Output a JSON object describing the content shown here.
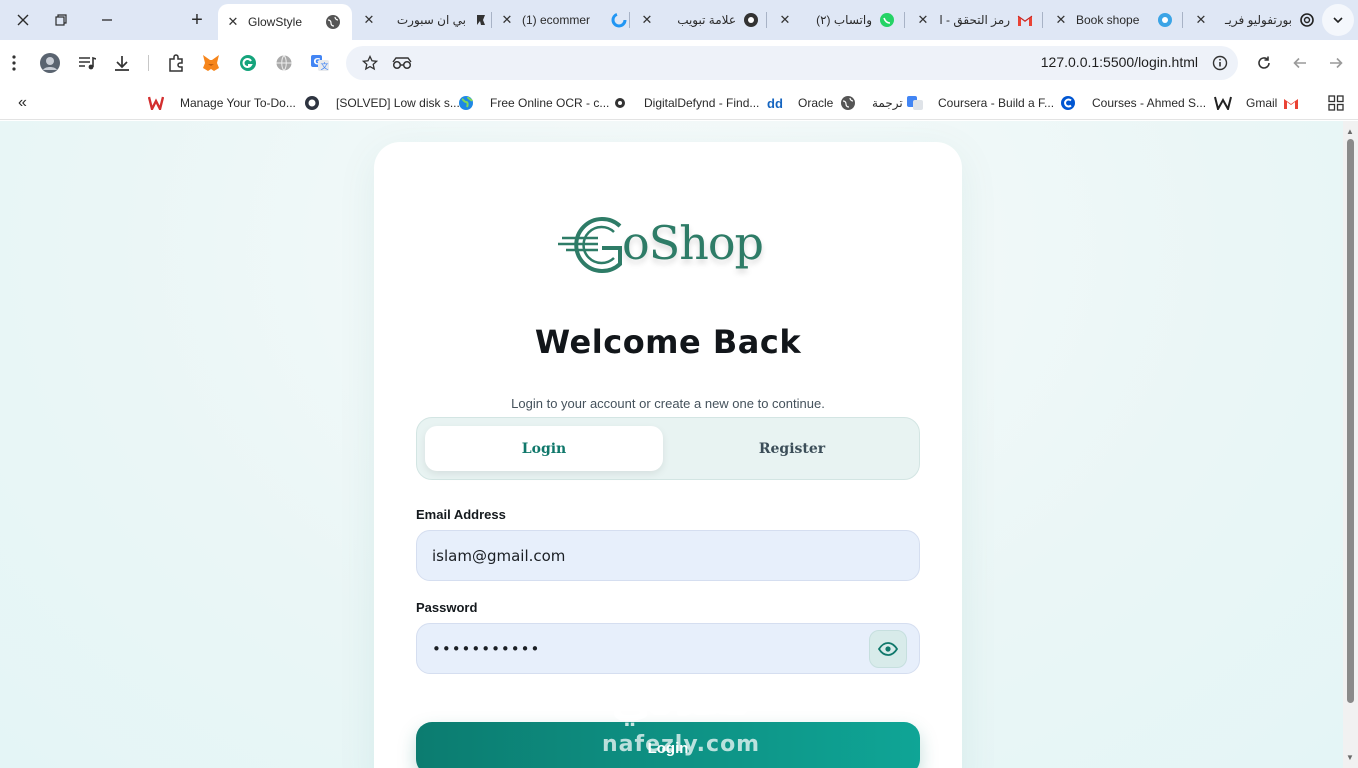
{
  "browser": {
    "tabs": [
      {
        "title": "بورتفوليو فريـ",
        "icon": "chatgpt-icon"
      },
      {
        "title": "Book shope",
        "icon": "circle-blue-icon"
      },
      {
        "title": "رمز التحقق - ا",
        "icon": "gmail-icon"
      },
      {
        "title": "(٢) واتساب",
        "icon": "whatsapp-icon"
      },
      {
        "title": "علامة تبويب",
        "icon": "chrome-icon"
      },
      {
        "title": "(1) ecommer",
        "icon": "blue-spinner-icon"
      },
      {
        "title": "بي ان سبورت",
        "icon": "pin-icon"
      },
      {
        "title": "GlowStyle",
        "icon": "globe-icon",
        "active": true
      }
    ],
    "new_tab": "+",
    "url": "127.0.0.1:5500/login.html",
    "bookmarks": [
      {
        "label": "Gmail",
        "icon": "gmail-icon"
      },
      {
        "label": "Courses - Ahmed S...",
        "icon": "w-logo-icon"
      },
      {
        "label": "Coursera - Build a F...",
        "icon": "coursera-icon"
      },
      {
        "label": "ترجمة",
        "icon": "translate-icon"
      },
      {
        "label": "Oracle",
        "icon": "globe-icon"
      },
      {
        "label": "DigitalDefynd - Find...",
        "icon": "dd-icon"
      },
      {
        "label": "Free Online OCR - c...",
        "icon": "ocr-icon"
      },
      {
        "label": "[SOLVED] Low disk s...",
        "icon": "earth-icon"
      },
      {
        "label": "Manage Your To-Do...",
        "icon": "circle-dark-icon"
      }
    ],
    "bookmarks_more": "«"
  },
  "page": {
    "brand": "oShop",
    "welcome": "Welcome Back",
    "subtitle": "Login to your account or create a new one to continue.",
    "tabs": {
      "login": "Login",
      "register": "Register"
    },
    "email_label": "Email Address",
    "email_value": "islam@gmail.com",
    "password_label": "Password",
    "password_value": "•••••••••••",
    "submit": "Login"
  },
  "watermark": {
    "arabic": "نفذلي",
    "latin": "nafezly.com"
  },
  "colors": {
    "accent": "#10786b",
    "accent_light": "#0fa596",
    "field_bg": "#e7effb",
    "page_bg": "#eaf6f6"
  }
}
